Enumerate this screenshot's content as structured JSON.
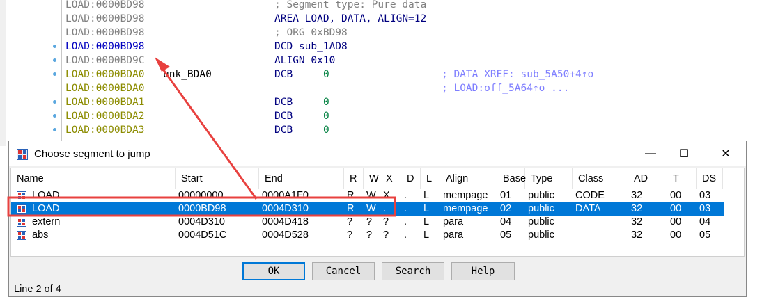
{
  "listing": {
    "lines": [
      {
        "addr": "LOAD:0000BD98",
        "addr_color": "gray",
        "name": "",
        "instr": "; Segment type: Pure data",
        "op": "",
        "cmt": "",
        "dot": false,
        "instr_color": "gray"
      },
      {
        "addr": "LOAD:0000BD98",
        "addr_color": "gray",
        "name": "",
        "instr": "AREA LOAD, DATA, ALIGN=12",
        "op": "",
        "cmt": "",
        "dot": false
      },
      {
        "addr": "LOAD:0000BD98",
        "addr_color": "gray",
        "name": "",
        "instr": "; ORG 0xBD98",
        "op": "",
        "cmt": "",
        "dot": false,
        "instr_color": "gray"
      },
      {
        "addr": "LOAD:0000BD98",
        "addr_color": "blue",
        "name": "",
        "instr": "DCD sub_1AD8",
        "op": "",
        "cmt": "",
        "dot": true
      },
      {
        "addr": "LOAD:0000BD9C",
        "addr_color": "gray",
        "name": "",
        "instr": "ALIGN 0x10",
        "op": "",
        "cmt": "",
        "dot": true
      },
      {
        "addr": "LOAD:0000BDA0",
        "addr_color": "olive",
        "name": "unk_BDA0",
        "instr": "DCB",
        "op": "0",
        "cmt": "; DATA XREF: sub_5A50+4↑o",
        "dot": true
      },
      {
        "addr": "LOAD:0000BDA0",
        "addr_color": "olive",
        "name": "",
        "instr": "",
        "op": "",
        "cmt": "; LOAD:off_5A64↑o ...",
        "dot": false
      },
      {
        "addr": "LOAD:0000BDA1",
        "addr_color": "olive",
        "name": "",
        "instr": "DCB",
        "op": "0",
        "cmt": "",
        "dot": true
      },
      {
        "addr": "LOAD:0000BDA2",
        "addr_color": "olive",
        "name": "",
        "instr": "DCB",
        "op": "0",
        "cmt": "",
        "dot": true
      },
      {
        "addr": "LOAD:0000BDA3",
        "addr_color": "olive",
        "name": "",
        "instr": "DCB",
        "op": "0",
        "cmt": "",
        "dot": true
      }
    ]
  },
  "dialog": {
    "title": "Choose segment to jump",
    "columns": [
      "Name",
      "Start",
      "End",
      "R",
      "W",
      "X",
      "D",
      "L",
      "Align",
      "Base",
      "Type",
      "Class",
      "AD",
      "T",
      "DS"
    ],
    "rows": [
      [
        "LOAD",
        "00000000",
        "0000A1F0",
        "R",
        "W",
        "X",
        ".",
        "L",
        "mempage",
        "01",
        "public",
        "CODE",
        "32",
        "00",
        "03"
      ],
      [
        "LOAD",
        "0000BD98",
        "0004D310",
        "R",
        "W",
        ".",
        ".",
        "L",
        "mempage",
        "02",
        "public",
        "DATA",
        "32",
        "00",
        "03"
      ],
      [
        "extern",
        "0004D310",
        "0004D418",
        "?",
        "?",
        "?",
        ".",
        "L",
        "para",
        "04",
        "public",
        "",
        "32",
        "00",
        "04"
      ],
      [
        "abs",
        "0004D51C",
        "0004D528",
        "?",
        "?",
        "?",
        ".",
        "L",
        "para",
        "05",
        "public",
        "",
        "32",
        "00",
        "05"
      ]
    ],
    "selected_row": 1,
    "buttons": {
      "ok": "OK",
      "cancel": "Cancel",
      "search": "Search",
      "help": "Help"
    },
    "status": "Line 2 of 4",
    "window_controls": {
      "minimize": "—",
      "maximize": "☐",
      "close": "✕"
    }
  },
  "colors": {
    "selection": "#0078d7",
    "annotation": "#e8413f"
  }
}
